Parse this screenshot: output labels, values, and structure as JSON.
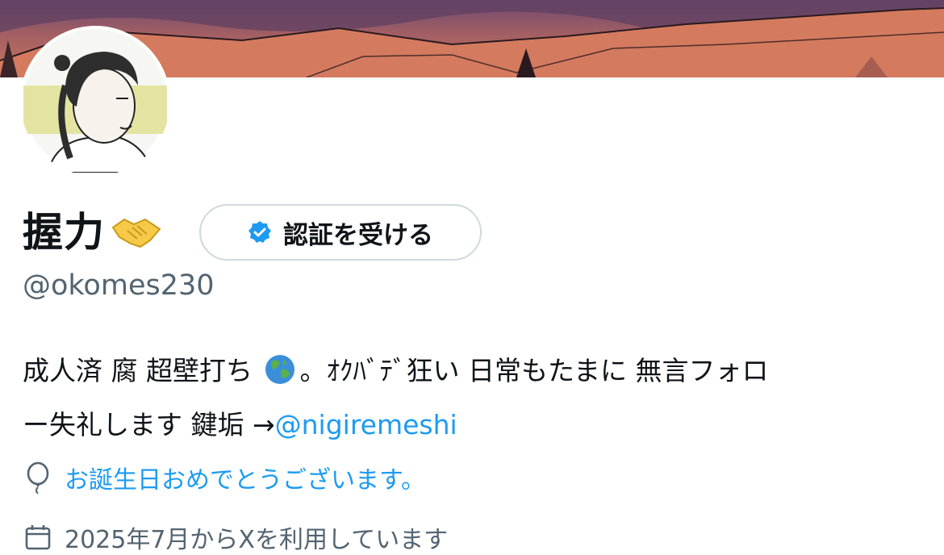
{
  "profile": {
    "display_name": "握力",
    "name_emoji": "handshake-icon",
    "handle": "@okomes230",
    "verify_button_label": "認証を受ける",
    "bio": {
      "line1_a": "成人済 腐 超壁打ち ",
      "line1_b": "。ｵｸﾊﾞﾃﾞ狂い 日常もたまに 無言フォロ",
      "line2_a": "ー失礼します 鍵垢 →",
      "mention": "@nigiremeshi"
    },
    "birthday_text": "お誕生日おめでとうございます。",
    "joined_text": "2025年7月からXを利用しています"
  },
  "colors": {
    "accent": "#1d9bf0",
    "secondary_text": "#536471",
    "primary_text": "#0f1419",
    "border": "#cfd9de"
  }
}
